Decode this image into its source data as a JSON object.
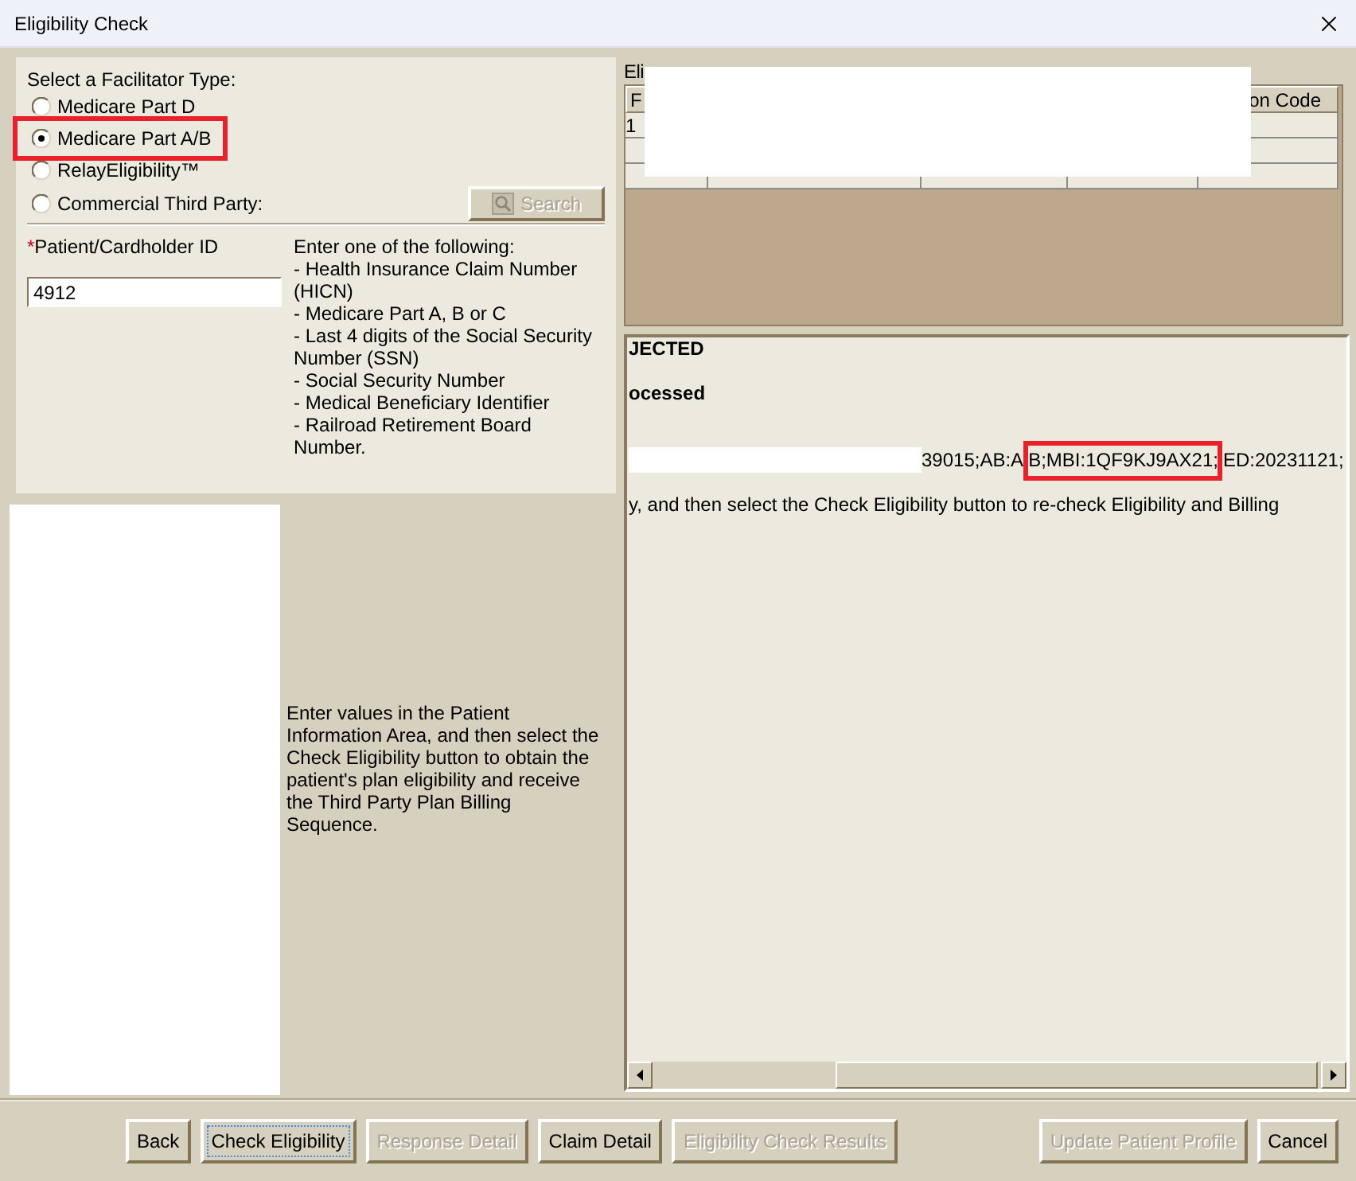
{
  "window": {
    "title": "Eligibility Check"
  },
  "facilitator": {
    "label": "Select a Facilitator Type:",
    "options": [
      {
        "label": "Medicare Part D",
        "selected": false,
        "highlighted": false
      },
      {
        "label": "Medicare Part A/B",
        "selected": true,
        "highlighted": true
      },
      {
        "label": "RelayEligibility™",
        "selected": false,
        "highlighted": false
      },
      {
        "label": "Commercial Third Party:",
        "selected": false,
        "highlighted": false
      }
    ],
    "search_button": {
      "label": "Search",
      "disabled": true
    }
  },
  "patient_id": {
    "required_mark": "*",
    "label": "Patient/Cardholder ID",
    "value": "4912"
  },
  "id_help": {
    "title": "Enter one of the following:",
    "items": [
      "- Health Insurance Claim Number (HICN)",
      "- Medicare Part A, B or C",
      "- Last 4 digits of the Social Security Number (SSN)",
      "- Social Security Number",
      "- Medical Beneficiary Identifier",
      "- Railroad Retirement Board Number."
    ]
  },
  "instructions": "Enter values in the Patient Information Area, and then select the Check Eligibility button to obtain the patient's plan eligibility and receive the Third Party Plan Billing Sequence.",
  "results_table": {
    "label": "Eli",
    "first_heading": "F",
    "last_heading": "on Code",
    "rows": [
      {
        "column_1": "1"
      }
    ]
  },
  "response": {
    "lines": [
      {
        "kind": "status",
        "text": "JECTED"
      },
      {
        "kind": "status",
        "text": "ocessed"
      },
      {
        "kind": "data",
        "parts": [
          {
            "text": "39015;AB:A",
            "highlighted": false
          },
          {
            "text": "B;MBI:1QF9KJ9AX21;",
            "highlighted": true
          },
          {
            "text": "ED:20231121;",
            "highlighted": false
          }
        ]
      },
      {
        "kind": "note",
        "text": "y, and then select the Check Eligibility button to re-check Eligibility and Billing"
      }
    ]
  },
  "buttons": {
    "left": [
      {
        "label": "Back",
        "disabled": false,
        "focused": false
      },
      {
        "label": "Check Eligibility",
        "disabled": false,
        "focused": true
      },
      {
        "label": "Response Detail",
        "disabled": true,
        "focused": false
      },
      {
        "label": "Claim Detail",
        "disabled": false,
        "focused": false
      },
      {
        "label": "Eligibility Check Results",
        "disabled": true,
        "focused": false
      }
    ],
    "right": [
      {
        "label": "Update Patient Profile",
        "disabled": true,
        "focused": false
      },
      {
        "label": "Cancel",
        "disabled": false,
        "focused": false
      }
    ]
  }
}
